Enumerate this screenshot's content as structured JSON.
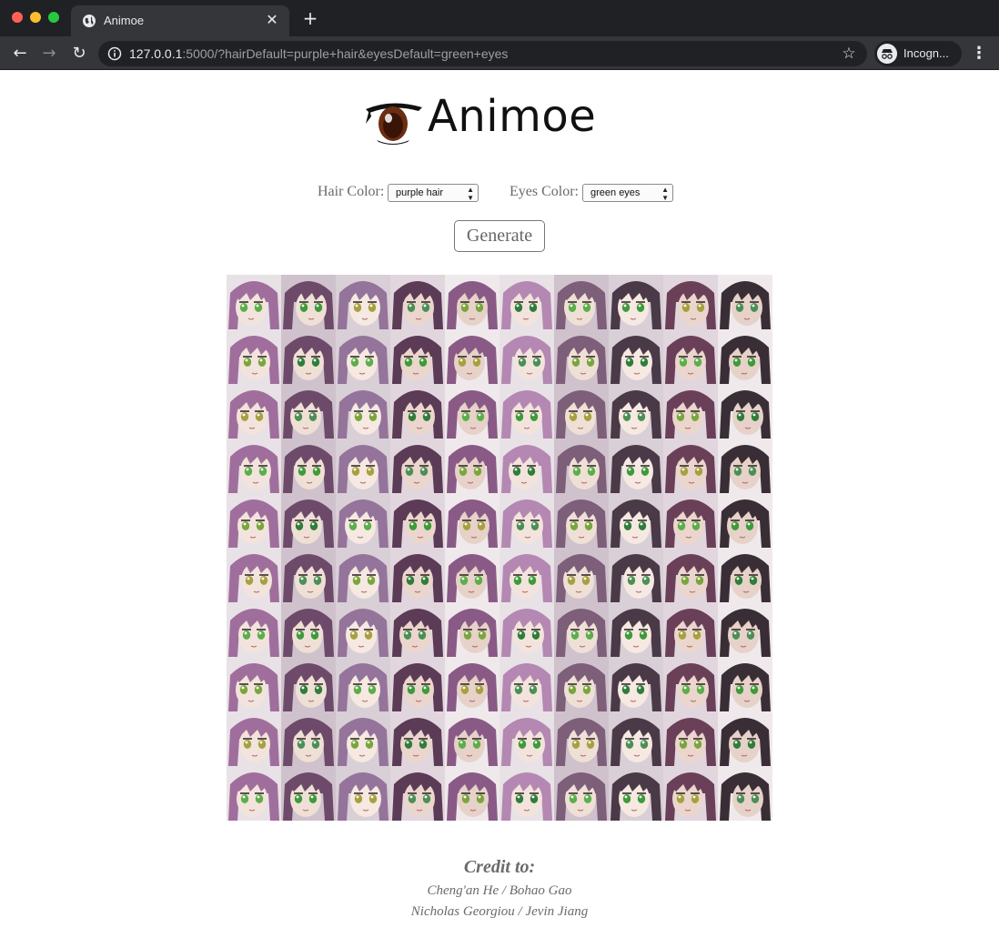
{
  "browser": {
    "tab_title": "Animoe",
    "url_host": "127.0.0.1",
    "url_rest": ":5000/?hairDefault=purple+hair&eyesDefault=green+eyes",
    "profile_label": "Incogn...",
    "icons": [
      "globe-icon",
      "close-icon",
      "plus-icon",
      "back-icon",
      "forward-icon",
      "reload-icon",
      "info-icon",
      "star-icon",
      "incognito-icon",
      "kebab-menu-icon"
    ]
  },
  "header": {
    "logo_text": "Animoe"
  },
  "form": {
    "hair_label": "Hair Color:",
    "hair_value": "purple hair",
    "eyes_label": "Eyes Color:",
    "eyes_value": "green eyes",
    "generate_label": "Generate"
  },
  "gallery": {
    "rows": 10,
    "columns": 10
  },
  "credit": {
    "title": "Credit to:",
    "line1": "Cheng'an He / Bohao Gao",
    "line2": "Nicholas Georgiou / Jevin Jiang"
  },
  "colors": {
    "chrome_dark": "#202124",
    "chrome_mid": "#35363a",
    "text_gray": "#6a6a6a"
  }
}
